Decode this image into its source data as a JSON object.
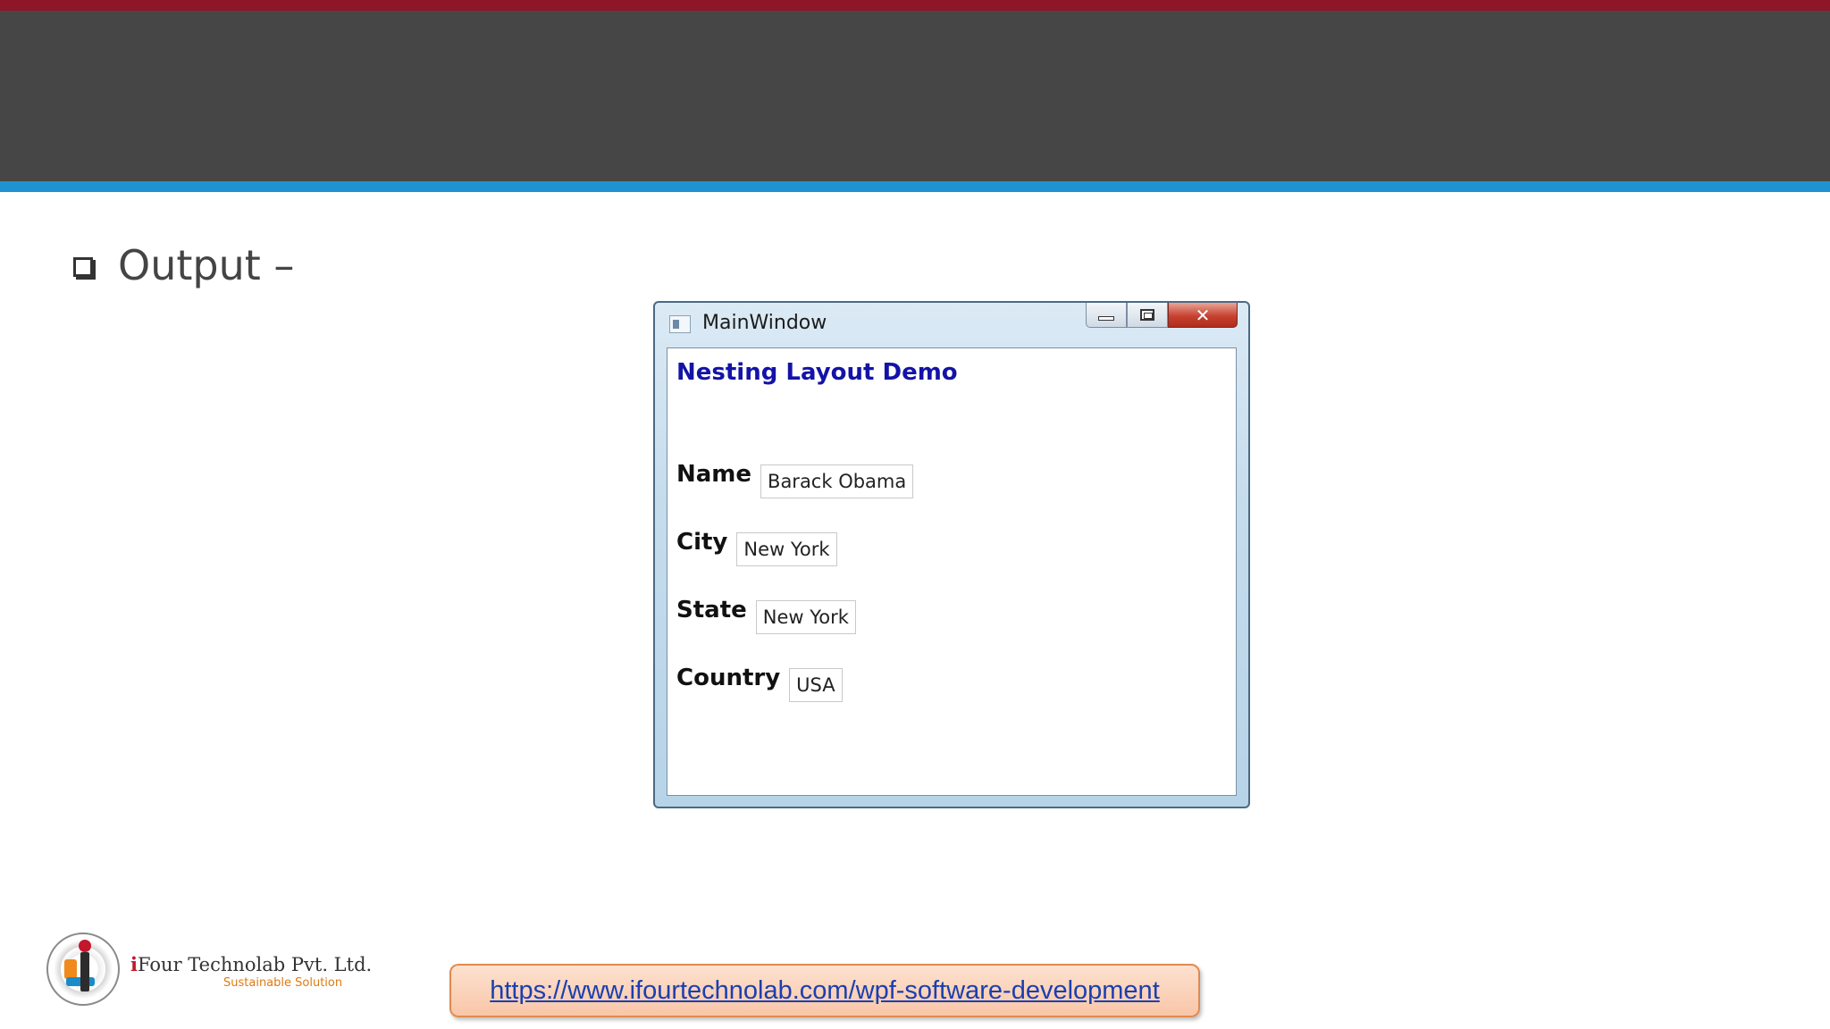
{
  "slide": {
    "bullet_text": "Output –"
  },
  "window": {
    "title": "MainWindow",
    "close_glyph": "✕",
    "heading": "Nesting Layout Demo",
    "fields": [
      {
        "label": "Name",
        "value": "Barack Obama"
      },
      {
        "label": "City",
        "value": "New York"
      },
      {
        "label": "State",
        "value": "New York"
      },
      {
        "label": "Country",
        "value": "USA"
      }
    ]
  },
  "footer": {
    "company_first": "i",
    "company_rest": "Four Technolab Pvt. Ltd.",
    "tagline": "Sustainable Solution",
    "url": "https://www.ifourtechnolab.com/wpf-software-development"
  },
  "colors": {
    "top_band_red": "#8e1629",
    "header_dark": "#464646",
    "accent_blue": "#1f93d2",
    "heading_blue": "#1313a8"
  }
}
